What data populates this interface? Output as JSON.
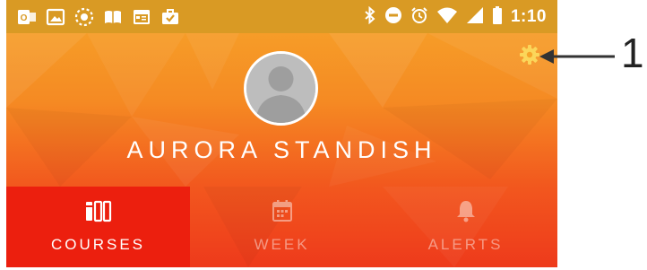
{
  "status_bar": {
    "time": "1:10",
    "left_icons": [
      "outlook-notification-icon",
      "image-notification-icon",
      "sync-notification-icon",
      "book-notification-icon",
      "calendar-notification-icon",
      "briefcase-check-icon"
    ],
    "right_icons": [
      "bluetooth-icon",
      "do-not-disturb-icon",
      "alarm-icon",
      "wifi-icon",
      "signal-icon",
      "battery-icon"
    ]
  },
  "profile": {
    "name": "AURORA STANDISH",
    "avatar": "default-avatar"
  },
  "tabs": [
    {
      "label": "COURSES",
      "icon": "courses-icon",
      "active": true
    },
    {
      "label": "WEEK",
      "icon": "calendar-icon",
      "active": false
    },
    {
      "label": "ALERTS",
      "icon": "bell-icon",
      "active": false
    }
  ],
  "annotation": {
    "number": "1"
  },
  "colors": {
    "gradient_top": "#f6a52a",
    "gradient_bottom": "#ee3a1b",
    "active_tab": "#ec1f0e",
    "status_bar": "#d99a24"
  }
}
